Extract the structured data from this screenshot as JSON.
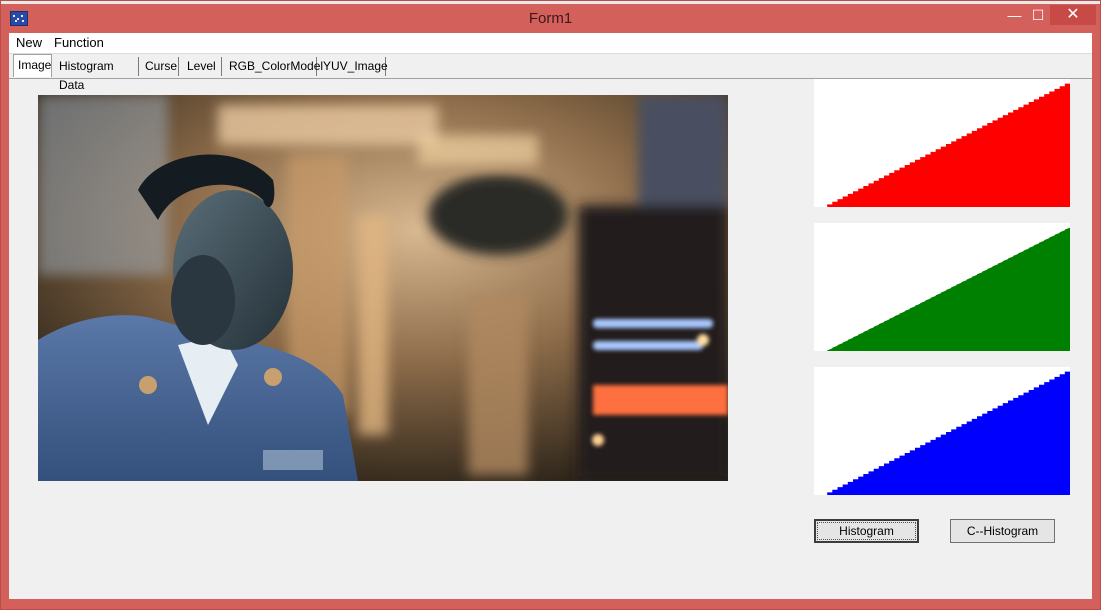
{
  "window": {
    "title": "Form1",
    "controls": {
      "minimize": "—",
      "maximize": "☐",
      "close": "✕"
    }
  },
  "menu": [
    "New",
    "Function"
  ],
  "tabs": [
    {
      "label": "Image",
      "active": true
    },
    {
      "label": "Histogram Data",
      "active": false
    },
    {
      "label": "Curse",
      "active": false
    },
    {
      "label": "Level",
      "active": false
    },
    {
      "label": "RGB_ColorModel",
      "active": false
    },
    {
      "label": "YUV_Image",
      "active": false
    }
  ],
  "histograms": [
    {
      "channel": "red",
      "color": "#ff0000"
    },
    {
      "channel": "green",
      "color": "#008000"
    },
    {
      "channel": "blue",
      "color": "#0000ff"
    }
  ],
  "buttons": {
    "histogram": "Histogram",
    "c_histogram": "C--Histogram"
  }
}
